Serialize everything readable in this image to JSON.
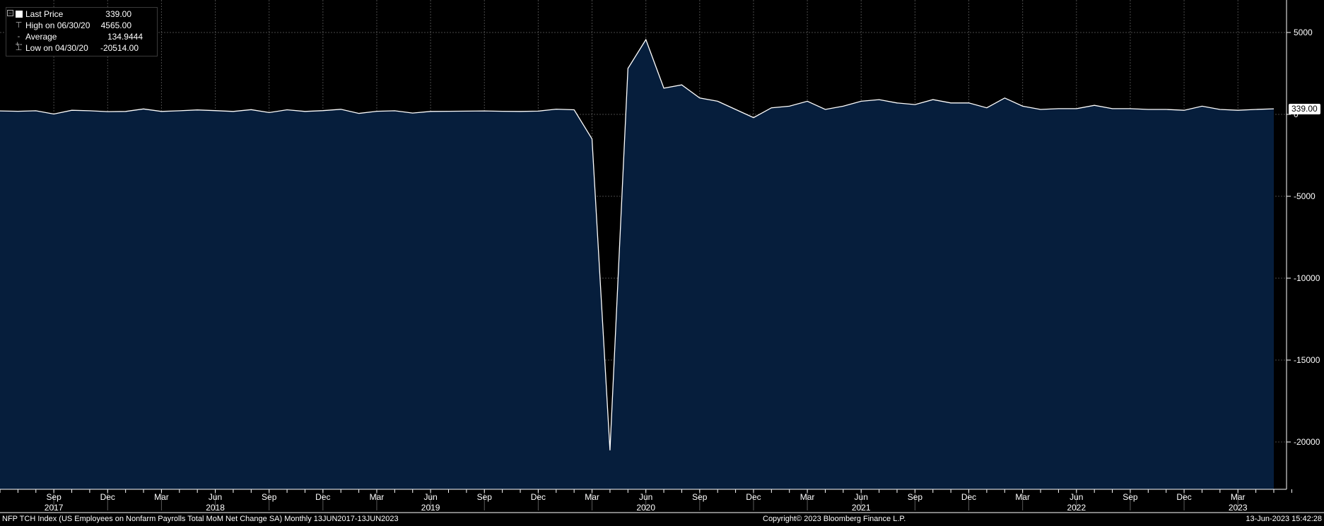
{
  "legend": {
    "items": [
      {
        "label": "Last Price",
        "value": "339.00",
        "glyph": "swatch"
      },
      {
        "label": "High on 06/30/20",
        "value": "4565.00",
        "glyph": "high"
      },
      {
        "label": "Average",
        "value": "134.9444",
        "glyph": "avg"
      },
      {
        "label": "Low on 04/30/20",
        "value": "-20514.00",
        "glyph": "low"
      }
    ]
  },
  "last_value_tag": "339.00",
  "footer": {
    "left": "NFP TCH Index (US Employees on Nonfarm Payrolls Total MoM Net Change SA)  Monthly 13JUN2017-13JUN2023",
    "center": "Copyright© 2023 Bloomberg Finance L.P.",
    "right": "13-Jun-2023 15:42:28"
  },
  "colors": {
    "background": "#000000",
    "area_fill": "#061e3c",
    "line": "#ffffff",
    "grid": "#7a7a7a"
  },
  "chart_data": {
    "type": "area",
    "title": "",
    "xlabel": "",
    "ylabel": "",
    "grid": true,
    "legend_position": "top-left",
    "ylim": [
      -22500,
      7000
    ],
    "y_ticks": [
      5000,
      0,
      -5000,
      -10000,
      -15000,
      -20000
    ],
    "y_tick_labels": [
      "5000",
      "0",
      "-5000",
      "-10000",
      "-15000",
      "-20000"
    ],
    "x_month_labels": [
      {
        "date": "2017-09",
        "label": "Sep"
      },
      {
        "date": "2017-12",
        "label": "Dec"
      },
      {
        "date": "2018-03",
        "label": "Mar"
      },
      {
        "date": "2018-06",
        "label": "Jun"
      },
      {
        "date": "2018-09",
        "label": "Sep"
      },
      {
        "date": "2018-12",
        "label": "Dec"
      },
      {
        "date": "2019-03",
        "label": "Mar"
      },
      {
        "date": "2019-06",
        "label": "Jun"
      },
      {
        "date": "2019-09",
        "label": "Sep"
      },
      {
        "date": "2019-12",
        "label": "Dec"
      },
      {
        "date": "2020-03",
        "label": "Mar"
      },
      {
        "date": "2020-06",
        "label": "Jun"
      },
      {
        "date": "2020-09",
        "label": "Sep"
      },
      {
        "date": "2020-12",
        "label": "Dec"
      },
      {
        "date": "2021-03",
        "label": "Mar"
      },
      {
        "date": "2021-06",
        "label": "Jun"
      },
      {
        "date": "2021-09",
        "label": "Sep"
      },
      {
        "date": "2021-12",
        "label": "Dec"
      },
      {
        "date": "2022-03",
        "label": "Mar"
      },
      {
        "date": "2022-06",
        "label": "Jun"
      },
      {
        "date": "2022-09",
        "label": "Sep"
      },
      {
        "date": "2022-12",
        "label": "Dec"
      },
      {
        "date": "2023-03",
        "label": "Mar"
      }
    ],
    "x_year_labels": [
      {
        "date": "2017-09",
        "label": "2017"
      },
      {
        "date": "2018-06",
        "label": "2018"
      },
      {
        "date": "2019-06",
        "label": "2019"
      },
      {
        "date": "2020-06",
        "label": "2020"
      },
      {
        "date": "2021-06",
        "label": "2021"
      },
      {
        "date": "2022-06",
        "label": "2022"
      },
      {
        "date": "2023-03",
        "label": "2023"
      }
    ],
    "x_start": "2017-06",
    "x": [
      "2017-06",
      "2017-07",
      "2017-08",
      "2017-09",
      "2017-10",
      "2017-11",
      "2017-12",
      "2018-01",
      "2018-02",
      "2018-03",
      "2018-04",
      "2018-05",
      "2018-06",
      "2018-07",
      "2018-08",
      "2018-09",
      "2018-10",
      "2018-11",
      "2018-12",
      "2019-01",
      "2019-02",
      "2019-03",
      "2019-04",
      "2019-05",
      "2019-06",
      "2019-07",
      "2019-08",
      "2019-09",
      "2019-10",
      "2019-11",
      "2019-12",
      "2020-01",
      "2020-02",
      "2020-03",
      "2020-04",
      "2020-05",
      "2020-06",
      "2020-07",
      "2020-08",
      "2020-09",
      "2020-10",
      "2020-11",
      "2020-12",
      "2021-01",
      "2021-02",
      "2021-03",
      "2021-04",
      "2021-05",
      "2021-06",
      "2021-07",
      "2021-08",
      "2021-09",
      "2021-10",
      "2021-11",
      "2021-12",
      "2022-01",
      "2022-02",
      "2022-03",
      "2022-04",
      "2022-05",
      "2022-06",
      "2022-07",
      "2022-08",
      "2022-09",
      "2022-10",
      "2022-11",
      "2022-12",
      "2023-01",
      "2023-02",
      "2023-03",
      "2023-04",
      "2023-05"
    ],
    "series": [
      {
        "values": [
          210,
          190,
          220,
          20,
          250,
          220,
          170,
          180,
          330,
          180,
          220,
          270,
          230,
          180,
          290,
          110,
          280,
          180,
          230,
          310,
          60,
          190,
          220,
          80,
          180,
          190,
          200,
          210,
          190,
          180,
          200,
          320,
          280,
          -1500,
          -20514,
          2800,
          4565,
          1600,
          1800,
          1000,
          800,
          300,
          -200,
          400,
          500,
          800,
          300,
          500,
          800,
          900,
          700,
          600,
          900,
          700,
          700,
          400,
          1000,
          500,
          300,
          350,
          350,
          550,
          350,
          350,
          300,
          300,
          250,
          500,
          300,
          250,
          300,
          339
        ]
      }
    ]
  }
}
